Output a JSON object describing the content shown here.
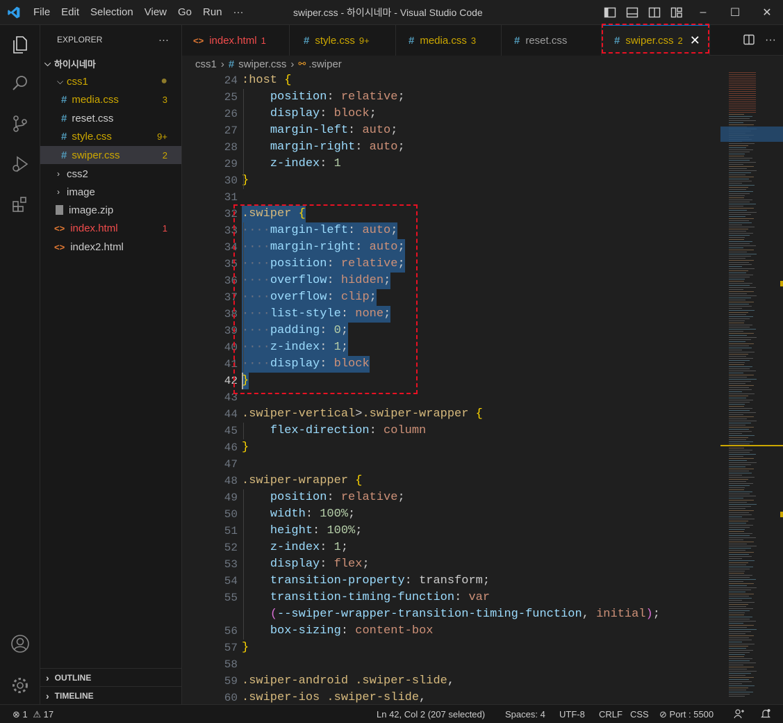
{
  "window": {
    "title": "swiper.css - 하이시네마 - Visual Studio Code"
  },
  "menu": [
    "File",
    "Edit",
    "Selection",
    "View",
    "Go",
    "Run",
    "···"
  ],
  "window_controls": {
    "minimize": "–",
    "maximize": "☐",
    "close": "✕"
  },
  "explorer": {
    "header": "EXPLORER",
    "more": "···",
    "root": "하이시네마",
    "items": [
      {
        "label": "css1",
        "type": "folder",
        "expanded": true
      },
      {
        "label": "media.css",
        "badge": "3",
        "status": "warning"
      },
      {
        "label": "reset.css",
        "badge": ""
      },
      {
        "label": "style.css",
        "badge": "9+",
        "status": "warning"
      },
      {
        "label": "swiper.css",
        "badge": "2",
        "status": "warning",
        "selected": true
      },
      {
        "label": "css2",
        "type": "folder",
        "expanded": false
      },
      {
        "label": "image",
        "type": "folder",
        "expanded": false
      },
      {
        "label": "image.zip",
        "badge": ""
      },
      {
        "label": "index.html",
        "badge": "1",
        "status": "error"
      },
      {
        "label": "index2.html",
        "badge": ""
      }
    ],
    "outline": "OUTLINE",
    "timeline": "TIMELINE"
  },
  "tabs": [
    {
      "label": "index.html",
      "count": "1",
      "status": "error"
    },
    {
      "label": "style.css",
      "count": "9+",
      "status": "warning"
    },
    {
      "label": "media.css",
      "count": "3",
      "status": "warning"
    },
    {
      "label": "reset.css",
      "count": ""
    },
    {
      "label": "swiper.css",
      "count": "2",
      "status": "warning",
      "active": true
    }
  ],
  "breadcrumb": {
    "folder": "css1",
    "file": "swiper.css",
    "symbol": ".swiper"
  },
  "editor": {
    "current_line": 42,
    "lines": [
      {
        "n": "24",
        "tokens": [
          [
            "sel",
            ":host"
          ],
          [
            "pu",
            " "
          ],
          [
            "br",
            "{"
          ]
        ]
      },
      {
        "n": "25",
        "tokens": [
          [
            "pu",
            "    "
          ],
          [
            "prop",
            "position"
          ],
          [
            "pu",
            ": "
          ],
          [
            "val",
            "relative"
          ],
          [
            "pu",
            ";"
          ]
        ]
      },
      {
        "n": "26",
        "tokens": [
          [
            "pu",
            "    "
          ],
          [
            "prop",
            "display"
          ],
          [
            "pu",
            ": "
          ],
          [
            "val",
            "block"
          ],
          [
            "pu",
            ";"
          ]
        ]
      },
      {
        "n": "27",
        "tokens": [
          [
            "pu",
            "    "
          ],
          [
            "prop",
            "margin-left"
          ],
          [
            "pu",
            ": "
          ],
          [
            "val",
            "auto"
          ],
          [
            "pu",
            ";"
          ]
        ]
      },
      {
        "n": "28",
        "tokens": [
          [
            "pu",
            "    "
          ],
          [
            "prop",
            "margin-right"
          ],
          [
            "pu",
            ": "
          ],
          [
            "val",
            "auto"
          ],
          [
            "pu",
            ";"
          ]
        ]
      },
      {
        "n": "29",
        "tokens": [
          [
            "pu",
            "    "
          ],
          [
            "prop",
            "z-index"
          ],
          [
            "pu",
            ": "
          ],
          [
            "num",
            "1"
          ]
        ]
      },
      {
        "n": "30",
        "tokens": [
          [
            "br",
            "}"
          ]
        ]
      },
      {
        "n": "31",
        "tokens": []
      },
      {
        "n": "32",
        "tokens": [
          [
            "sel",
            ".swiper"
          ],
          [
            "pu",
            " "
          ],
          [
            "br",
            "{"
          ]
        ],
        "selected": true
      },
      {
        "n": "33",
        "tokens": [
          [
            "dots",
            "····"
          ],
          [
            "prop",
            "margin-left"
          ],
          [
            "pu",
            ": "
          ],
          [
            "val",
            "auto"
          ],
          [
            "pu",
            ";"
          ]
        ],
        "selected": true
      },
      {
        "n": "34",
        "tokens": [
          [
            "dots",
            "····"
          ],
          [
            "prop",
            "margin-right"
          ],
          [
            "pu",
            ": "
          ],
          [
            "val",
            "auto"
          ],
          [
            "pu",
            ";"
          ]
        ],
        "selected": true
      },
      {
        "n": "35",
        "tokens": [
          [
            "dots",
            "····"
          ],
          [
            "prop",
            "position"
          ],
          [
            "pu",
            ": "
          ],
          [
            "val",
            "relative"
          ],
          [
            "pu",
            ";"
          ]
        ],
        "selected": true
      },
      {
        "n": "36",
        "tokens": [
          [
            "dots",
            "····"
          ],
          [
            "prop",
            "overflow"
          ],
          [
            "pu",
            ": "
          ],
          [
            "val",
            "hidden"
          ],
          [
            "pu",
            ";"
          ]
        ],
        "selected": true
      },
      {
        "n": "37",
        "tokens": [
          [
            "dots",
            "····"
          ],
          [
            "prop",
            "overflow"
          ],
          [
            "pu",
            ": "
          ],
          [
            "val",
            "clip"
          ],
          [
            "pu",
            ";"
          ]
        ],
        "selected": true
      },
      {
        "n": "38",
        "tokens": [
          [
            "dots",
            "····"
          ],
          [
            "prop",
            "list-style"
          ],
          [
            "pu",
            ": "
          ],
          [
            "val",
            "none"
          ],
          [
            "pu",
            ";"
          ]
        ],
        "selected": true
      },
      {
        "n": "39",
        "tokens": [
          [
            "dots",
            "····"
          ],
          [
            "prop",
            "padding"
          ],
          [
            "pu",
            ": "
          ],
          [
            "num",
            "0"
          ],
          [
            "pu",
            ";"
          ]
        ],
        "selected": true
      },
      {
        "n": "40",
        "tokens": [
          [
            "dots",
            "····"
          ],
          [
            "prop",
            "z-index"
          ],
          [
            "pu",
            ": "
          ],
          [
            "num",
            "1"
          ],
          [
            "pu",
            ";"
          ]
        ],
        "selected": true
      },
      {
        "n": "41",
        "tokens": [
          [
            "dots",
            "····"
          ],
          [
            "prop",
            "display"
          ],
          [
            "pu",
            ": "
          ],
          [
            "val",
            "block"
          ]
        ],
        "selected": true
      },
      {
        "n": "42",
        "tokens": [
          [
            "br",
            "}"
          ]
        ],
        "selected": true
      },
      {
        "n": "43",
        "tokens": []
      },
      {
        "n": "44",
        "tokens": [
          [
            "sel",
            ".swiper-vertical"
          ],
          [
            "pu",
            ">"
          ],
          [
            "sel",
            ".swiper-wrapper"
          ],
          [
            "pu",
            " "
          ],
          [
            "br",
            "{"
          ]
        ]
      },
      {
        "n": "45",
        "tokens": [
          [
            "pu",
            "    "
          ],
          [
            "prop",
            "flex-direction"
          ],
          [
            "pu",
            ": "
          ],
          [
            "val",
            "column"
          ]
        ]
      },
      {
        "n": "46",
        "tokens": [
          [
            "br",
            "}"
          ]
        ]
      },
      {
        "n": "47",
        "tokens": []
      },
      {
        "n": "48",
        "tokens": [
          [
            "sel",
            ".swiper-wrapper"
          ],
          [
            "pu",
            " "
          ],
          [
            "br",
            "{"
          ]
        ]
      },
      {
        "n": "49",
        "tokens": [
          [
            "pu",
            "    "
          ],
          [
            "prop",
            "position"
          ],
          [
            "pu",
            ": "
          ],
          [
            "val",
            "relative"
          ],
          [
            "pu",
            ";"
          ]
        ]
      },
      {
        "n": "50",
        "tokens": [
          [
            "pu",
            "    "
          ],
          [
            "prop",
            "width"
          ],
          [
            "pu",
            ": "
          ],
          [
            "num",
            "100%"
          ],
          [
            "pu",
            ";"
          ]
        ]
      },
      {
        "n": "51",
        "tokens": [
          [
            "pu",
            "    "
          ],
          [
            "prop",
            "height"
          ],
          [
            "pu",
            ": "
          ],
          [
            "num",
            "100%"
          ],
          [
            "pu",
            ";"
          ]
        ]
      },
      {
        "n": "52",
        "tokens": [
          [
            "pu",
            "    "
          ],
          [
            "prop",
            "z-index"
          ],
          [
            "pu",
            ": "
          ],
          [
            "num",
            "1"
          ],
          [
            "pu",
            ";"
          ]
        ]
      },
      {
        "n": "53",
        "tokens": [
          [
            "pu",
            "    "
          ],
          [
            "prop",
            "display"
          ],
          [
            "pu",
            ": "
          ],
          [
            "val",
            "flex"
          ],
          [
            "pu",
            ";"
          ]
        ]
      },
      {
        "n": "54",
        "tokens": [
          [
            "pu",
            "    "
          ],
          [
            "prop",
            "transition-property"
          ],
          [
            "pu",
            ": "
          ],
          [
            "pu",
            "transform;"
          ]
        ]
      },
      {
        "n": "55",
        "tokens": [
          [
            "pu",
            "    "
          ],
          [
            "prop",
            "transition-timing-function"
          ],
          [
            "pu",
            ": "
          ],
          [
            "val",
            "var"
          ]
        ]
      },
      {
        "n": "",
        "tokens": [
          [
            "pu",
            "    "
          ],
          [
            "p2",
            "("
          ],
          [
            "var",
            "--swiper-wrapper-transition-timing-function"
          ],
          [
            "pu",
            ", "
          ],
          [
            "val",
            "initial"
          ],
          [
            "p2",
            ")"
          ],
          [
            "pu",
            ";"
          ]
        ]
      },
      {
        "n": "56",
        "tokens": [
          [
            "pu",
            "    "
          ],
          [
            "prop",
            "box-sizing"
          ],
          [
            "pu",
            ": "
          ],
          [
            "val",
            "content-box"
          ]
        ]
      },
      {
        "n": "57",
        "tokens": [
          [
            "br",
            "}"
          ]
        ]
      },
      {
        "n": "58",
        "tokens": []
      },
      {
        "n": "59",
        "tokens": [
          [
            "sel",
            ".swiper-android"
          ],
          [
            "pu",
            " "
          ],
          [
            "sel",
            ".swiper-slide"
          ],
          [
            "pu",
            ","
          ]
        ]
      },
      {
        "n": "60",
        "tokens": [
          [
            "sel",
            ".swiper-ios"
          ],
          [
            "pu",
            " "
          ],
          [
            "sel",
            ".swiper-slide"
          ],
          [
            "pu",
            ","
          ]
        ]
      }
    ]
  },
  "statusbar": {
    "errors": "1",
    "warnings": "17",
    "position": "Ln 42, Col 2 (207 selected)",
    "spaces": "Spaces: 4",
    "encoding": "UTF-8",
    "eol": "CRLF",
    "language": "CSS",
    "port": "Port : 5500"
  },
  "colors": {
    "accent": "#0078d4",
    "warning": "#cca700",
    "error": "#f14c4c",
    "selection": "#264f78",
    "annotation": "#e81123"
  }
}
